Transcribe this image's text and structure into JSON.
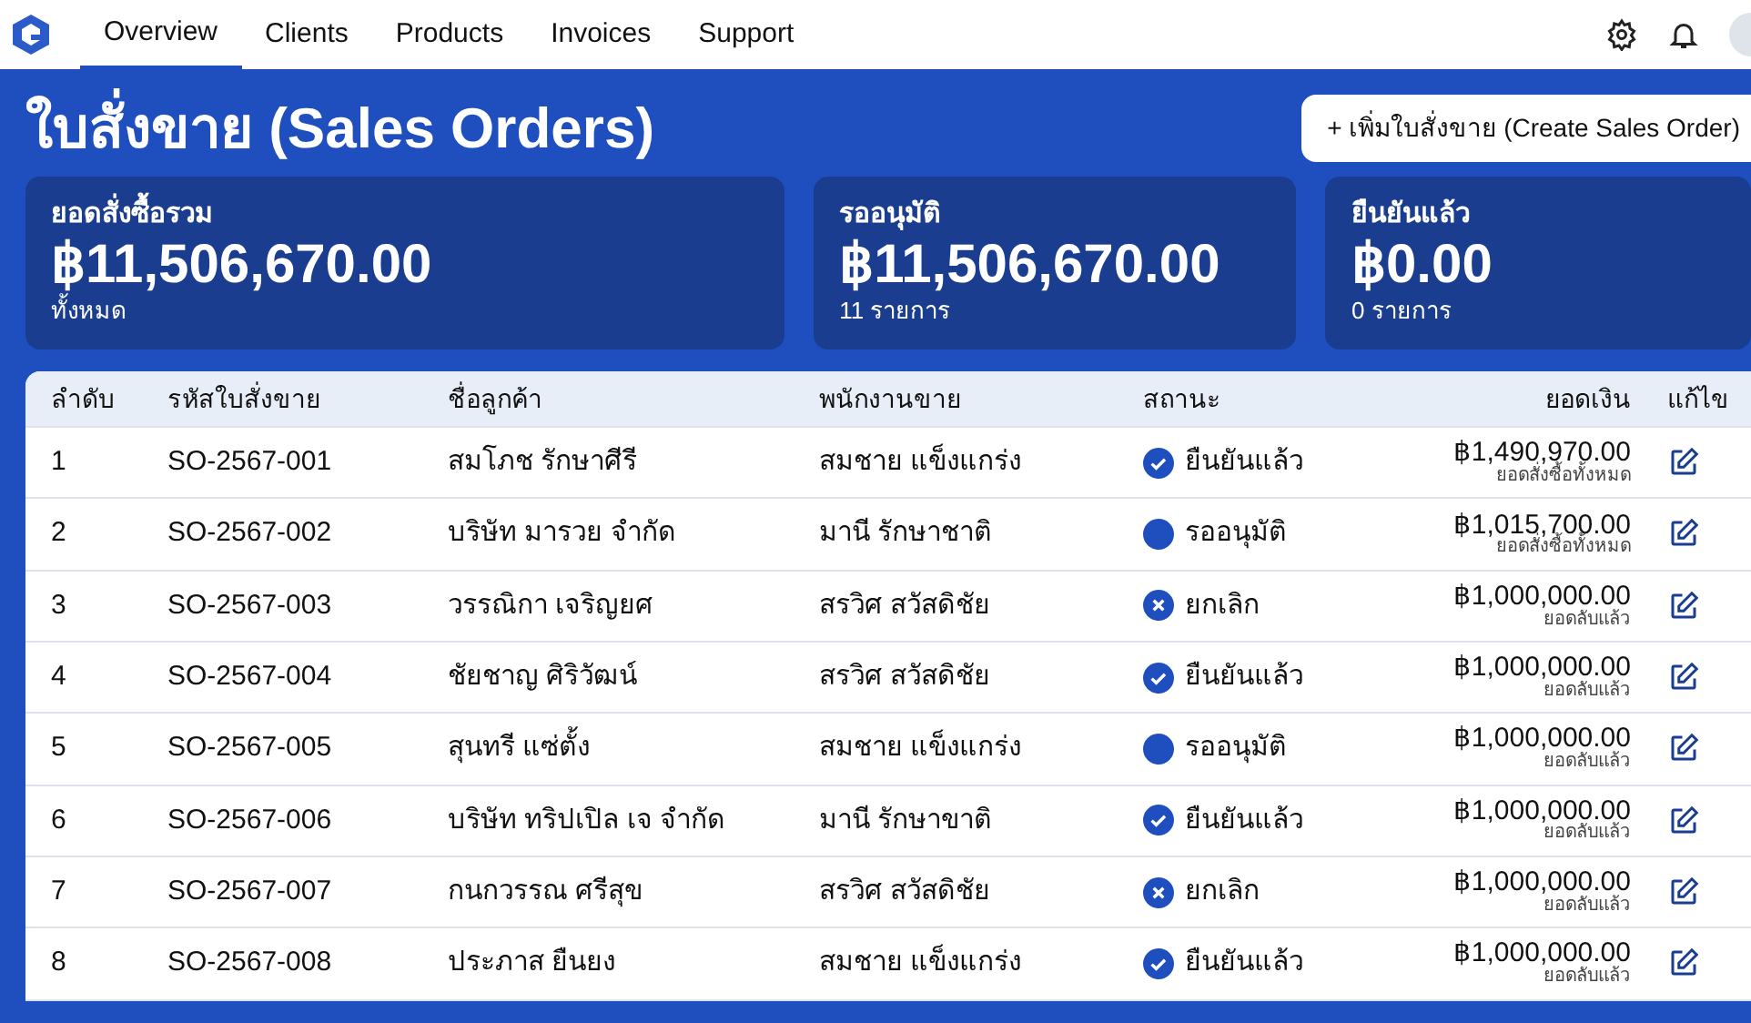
{
  "nav": {
    "items": [
      {
        "label": "Overview",
        "selected": true
      },
      {
        "label": "Clients",
        "selected": false
      },
      {
        "label": "Products",
        "selected": false
      },
      {
        "label": "Invoices",
        "selected": false
      },
      {
        "label": "Support",
        "selected": false
      }
    ]
  },
  "page": {
    "title": "ใบสั่งขาย (Sales Orders)",
    "create_button": "+ เพิ่มใบสั่งขาย (Create Sales Order)"
  },
  "stats": [
    {
      "label": "ยอดสั่งซื้อรวม",
      "value": "฿11,506,670.00",
      "sub": "ทั้งหมด"
    },
    {
      "label": "รออนุมัติ",
      "value": "฿11,506,670.00",
      "sub": "11 รายการ"
    },
    {
      "label": "ยืนยันแล้ว",
      "value": "฿0.00",
      "sub": "0 รายการ"
    }
  ],
  "table": {
    "columns": [
      "ลำดับ",
      "รหัสใบสั่งขาย",
      "ชื่อลูกค้า",
      "พนักงานขาย",
      "สถานะ",
      "ยอดเงิน",
      "แก้ไข"
    ],
    "rows": [
      {
        "no": "1",
        "code": "SO-2567-001",
        "customer": "สมโภช รักษาศีรี",
        "sales": "สมชาย แข็งแกร่ง",
        "status": {
          "kind": "confirmed",
          "label": "ยืนยันแล้ว"
        },
        "amount": "฿1,490,970.00",
        "amount_note": "ยอดสั่งซื้อทั้งหมด"
      },
      {
        "no": "2",
        "code": "SO-2567-002",
        "customer": "บริษัท มารวย จำกัด",
        "sales": "มานี รักษาชาติ",
        "status": {
          "kind": "pending",
          "label": "รออนุมัติ"
        },
        "amount": "฿1,015,700.00",
        "amount_note": "ยอดสั่งซื้อทั้งหมด"
      },
      {
        "no": "3",
        "code": "SO-2567-003",
        "customer": "วรรณิกา เจริญยศ",
        "sales": "สรวิศ สวัสดิชัย",
        "status": {
          "kind": "cancelled",
          "label": "ยกเลิก"
        },
        "amount": "฿1,000,000.00",
        "amount_note": "ยอดลับแล้ว"
      },
      {
        "no": "4",
        "code": "SO-2567-004",
        "customer": "ชัยชาญ ศิริวัฒน์",
        "sales": "สรวิศ สวัสดิชัย",
        "status": {
          "kind": "confirmed",
          "label": "ยืนยันแล้ว"
        },
        "amount": "฿1,000,000.00",
        "amount_note": "ยอดลับแล้ว"
      },
      {
        "no": "5",
        "code": "SO-2567-005",
        "customer": "สุนทรี แซ่ตั้ง",
        "sales": "สมชาย แข็งแกร่ง",
        "status": {
          "kind": "pending",
          "label": "รออนุมัติ"
        },
        "amount": "฿1,000,000.00",
        "amount_note": "ยอดลับแล้ว"
      },
      {
        "no": "6",
        "code": "SO-2567-006",
        "customer": "บริษัท ทริปเปิล เจ จำกัด",
        "sales": "มานี รักษาขาติ",
        "status": {
          "kind": "confirmed",
          "label": "ยืนยันแล้ว"
        },
        "amount": "฿1,000,000.00",
        "amount_note": "ยอดลับแล้ว"
      },
      {
        "no": "7",
        "code": "SO-2567-007",
        "customer": "กนกวรรณ ศรีสุข",
        "sales": "สรวิศ สวัสดิชัย",
        "status": {
          "kind": "cancelled",
          "label": "ยกเลิก"
        },
        "amount": "฿1,000,000.00",
        "amount_note": "ยอดลับแล้ว"
      },
      {
        "no": "8",
        "code": "SO-2567-008",
        "customer": "ประภาส ยืนยง",
        "sales": "สมชาย แข็งแกร่ง",
        "status": {
          "kind": "confirmed",
          "label": "ยืนยันแล้ว"
        },
        "amount": "฿1,000,000.00",
        "amount_note": "ยอดลับแล้ว"
      }
    ]
  }
}
